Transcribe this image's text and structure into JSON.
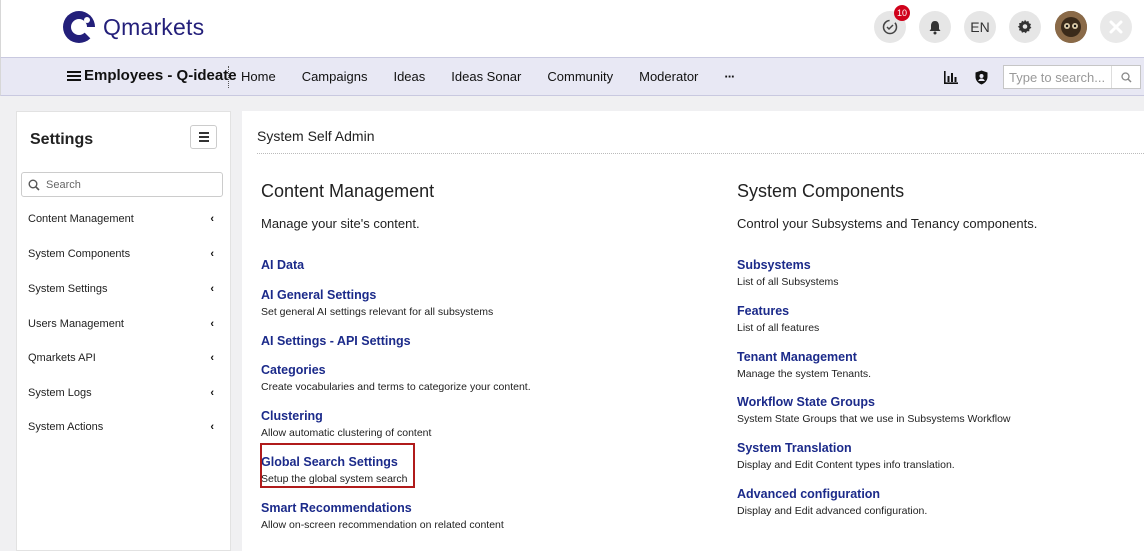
{
  "header": {
    "logo_text": "Qmarkets",
    "notification_count": "10",
    "language": "EN"
  },
  "nav": {
    "brand": "Employees - Q-ideate",
    "links": [
      "Home",
      "Campaigns",
      "Ideas",
      "Ideas Sonar",
      "Community",
      "Moderator"
    ],
    "more": "···",
    "search_placeholder": "Type to search..."
  },
  "sidebar": {
    "title": "Settings",
    "search_placeholder": "Search",
    "items": [
      {
        "label": "Content Management"
      },
      {
        "label": "System Components"
      },
      {
        "label": "System Settings"
      },
      {
        "label": "Users Management"
      },
      {
        "label": "Qmarkets API"
      },
      {
        "label": "System Logs"
      },
      {
        "label": "System Actions"
      }
    ]
  },
  "main": {
    "page_title": "System Self Admin",
    "content_management": {
      "title": "Content Management",
      "subtitle": "Manage your site's content.",
      "entries": [
        {
          "label": "AI Data",
          "desc": ""
        },
        {
          "label": "AI General Settings",
          "desc": "Set general AI settings relevant for all subsystems"
        },
        {
          "label": "AI Settings - API Settings",
          "desc": ""
        },
        {
          "label": "Categories",
          "desc": "Create vocabularies and terms to categorize your content."
        },
        {
          "label": "Clustering",
          "desc": "Allow automatic clustering of content"
        },
        {
          "label": "Global Search Settings",
          "desc": "Setup the global system search"
        },
        {
          "label": "Smart Recommendations",
          "desc": "Allow on-screen recommendation on related content"
        }
      ]
    },
    "system_components": {
      "title": "System Components",
      "subtitle": "Control your Subsystems and Tenancy components.",
      "entries": [
        {
          "label": "Subsystems",
          "desc": "List of all Subsystems"
        },
        {
          "label": "Features",
          "desc": "List of all features"
        },
        {
          "label": "Tenant Management",
          "desc": "Manage the system Tenants."
        },
        {
          "label": "Workflow State Groups",
          "desc": "System State Groups that we use in Subsystems Workflow"
        },
        {
          "label": "System Translation",
          "desc": "Display and Edit Content types info translation."
        },
        {
          "label": "Advanced configuration",
          "desc": "Display and Edit advanced configuration."
        }
      ]
    }
  },
  "colors": {
    "link": "#1b2a8a",
    "brand": "#231f7a",
    "nav_bg": "#e8e8f4",
    "badge": "#d0021b",
    "highlight": "#b01b1b"
  },
  "icons": [
    "qmarkets-logo-icon",
    "activity-icon",
    "bell-icon",
    "gear-icon",
    "avatar",
    "close-icon",
    "hamburger-icon",
    "chart-icon",
    "user-shield-icon",
    "search-icon",
    "chevron-left-icon"
  ]
}
